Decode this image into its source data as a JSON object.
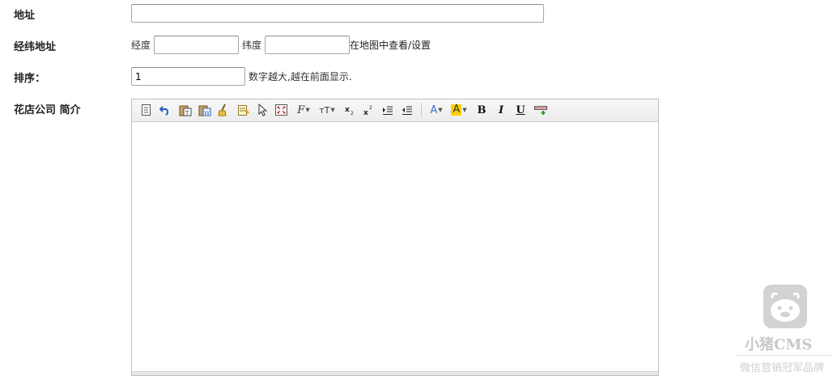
{
  "form": {
    "address": {
      "label": "地址",
      "value": ""
    },
    "coords": {
      "label": "经纬地址",
      "lng_label": "经度",
      "lng_value": "",
      "lat_label": "纬度",
      "lat_value": "",
      "map_link": "在地图中查看/设置"
    },
    "sort": {
      "label": "排序：",
      "value": "1",
      "hint": "数字越大,越在前面显示."
    },
    "intro": {
      "label": "花店公司 简介",
      "content": ""
    }
  },
  "toolbar": {
    "font_color_label": "A",
    "bg_color_label": "A",
    "bold_label": "B",
    "italic_label": "I",
    "underline_label": "U",
    "font_family_label": "F",
    "font_size_label": "тT",
    "colors": {
      "font_color": "#3b6fd4",
      "bg_color": "#ffd200"
    }
  },
  "watermark": {
    "brand": "小猪CMS",
    "slogan": "微信营销冠军品牌",
    "icon": "piglet-logo-icon"
  }
}
